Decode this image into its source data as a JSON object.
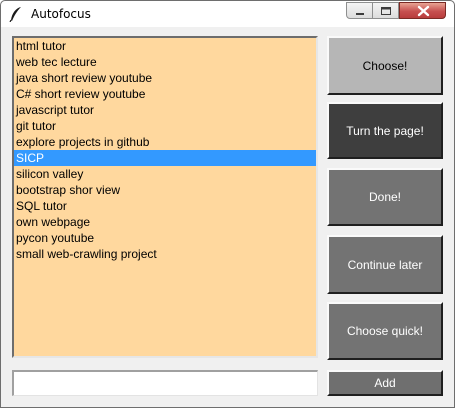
{
  "window": {
    "title": "Autofocus"
  },
  "icons": {
    "app": "feather-icon",
    "minimize": "minimize-icon",
    "maximize": "maximize-icon",
    "close": "close-icon"
  },
  "colors": {
    "list_background": "#ffd89e",
    "selection": "#3399ff",
    "choose_button": "#b6b6b6",
    "turn_page_button": "#3e3e3e",
    "other_buttons": "#737373",
    "add_button": "#6f6f6f"
  },
  "tasks": {
    "items": [
      "html tutor",
      "web tec lecture",
      "java short review youtube",
      "C# short review youtube",
      "javascript tutor",
      "git tutor",
      "explore projects in github",
      "SICP",
      "silicon valley",
      "bootstrap shor view",
      "SQL tutor",
      "own webpage",
      "pycon youtube",
      "small web-crawling project"
    ],
    "selected": "SICP"
  },
  "new_task": {
    "value": ""
  },
  "buttons": {
    "choose": "Choose!",
    "turn_page": "Turn the page!",
    "done": "Done!",
    "continue_later": "Continue later",
    "choose_quick": "Choose quick!",
    "add": "Add"
  }
}
